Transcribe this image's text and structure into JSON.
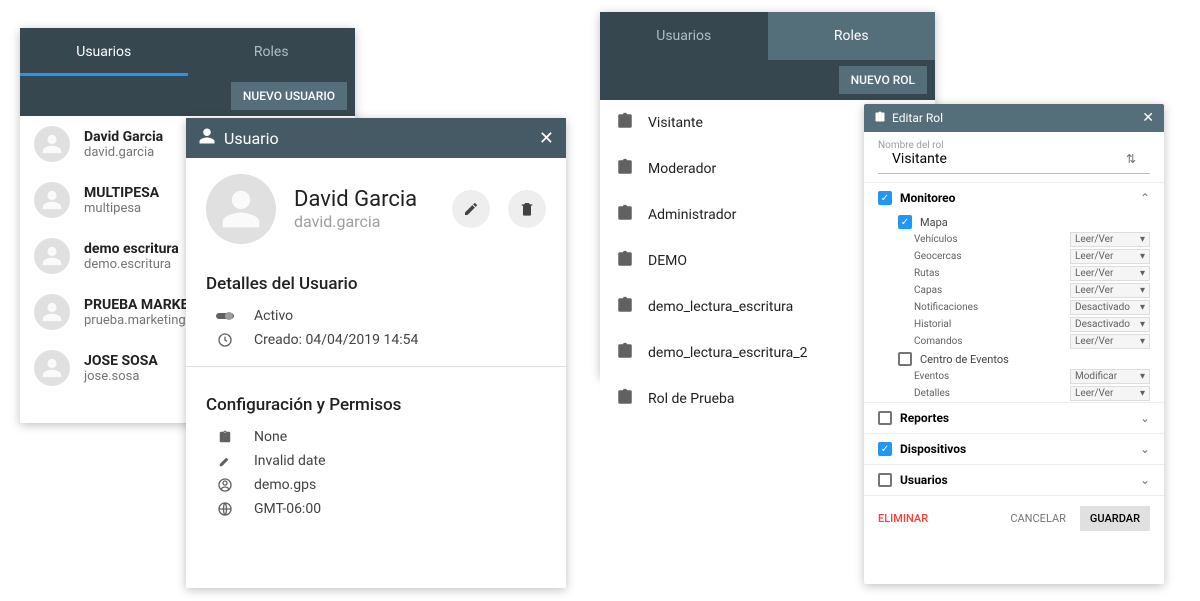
{
  "users_panel": {
    "tabs": {
      "users": "Usuarios",
      "roles": "Roles"
    },
    "new_button": "NUEVO USUARIO",
    "items": [
      {
        "name": "David Garcia",
        "sub": "david.garcia"
      },
      {
        "name": "MULTIPESA",
        "sub": "multipesa"
      },
      {
        "name": "demo escritura",
        "sub": "demo.escritura"
      },
      {
        "name": "PRUEBA MARKETING",
        "sub": "prueba.marketing"
      },
      {
        "name": "JOSE SOSA",
        "sub": "jose.sosa"
      }
    ]
  },
  "user_modal": {
    "title": "Usuario",
    "name": "David Garcia",
    "username": "david.garcia",
    "details_title": "Detalles del Usuario",
    "status": "Activo",
    "created": "Creado: 04/04/2019 14:54",
    "config_title": "Configuración y Permisos",
    "role": "None",
    "date": "Invalid date",
    "domain": "demo.gps",
    "tz": "GMT-06:00"
  },
  "roles_panel": {
    "tabs": {
      "users": "Usuarios",
      "roles": "Roles"
    },
    "new_button": "NUEVO ROL",
    "items": [
      "Visitante",
      "Moderador",
      "Administrador",
      "DEMO",
      "demo_lectura_escritura",
      "demo_lectura_escritura_2",
      "Rol de Prueba"
    ]
  },
  "edit_rol": {
    "title": "Editar Rol",
    "field_label": "Nombre del rol",
    "role_name": "Visitante",
    "sections": {
      "monitoreo": "Monitoreo",
      "mapa": "Mapa",
      "centro": "Centro de Eventos",
      "reportes": "Reportes",
      "dispositivos": "Dispositivos",
      "usuarios": "Usuarios"
    },
    "mapa_rows": [
      {
        "label": "Vehículos",
        "value": "Leer/Ver"
      },
      {
        "label": "Geocercas",
        "value": "Leer/Ver"
      },
      {
        "label": "Rutas",
        "value": "Leer/Ver"
      },
      {
        "label": "Capas",
        "value": "Leer/Ver"
      },
      {
        "label": "Notificaciones",
        "value": "Desactivado"
      },
      {
        "label": "Historial",
        "value": "Desactivado"
      },
      {
        "label": "Comandos",
        "value": "Leer/Ver"
      }
    ],
    "centro_rows": [
      {
        "label": "Eventos",
        "value": "Modificar"
      },
      {
        "label": "Detalles",
        "value": "Leer/Ver"
      }
    ],
    "footer": {
      "delete": "ELIMINAR",
      "cancel": "CANCELAR",
      "save": "GUARDAR"
    }
  }
}
